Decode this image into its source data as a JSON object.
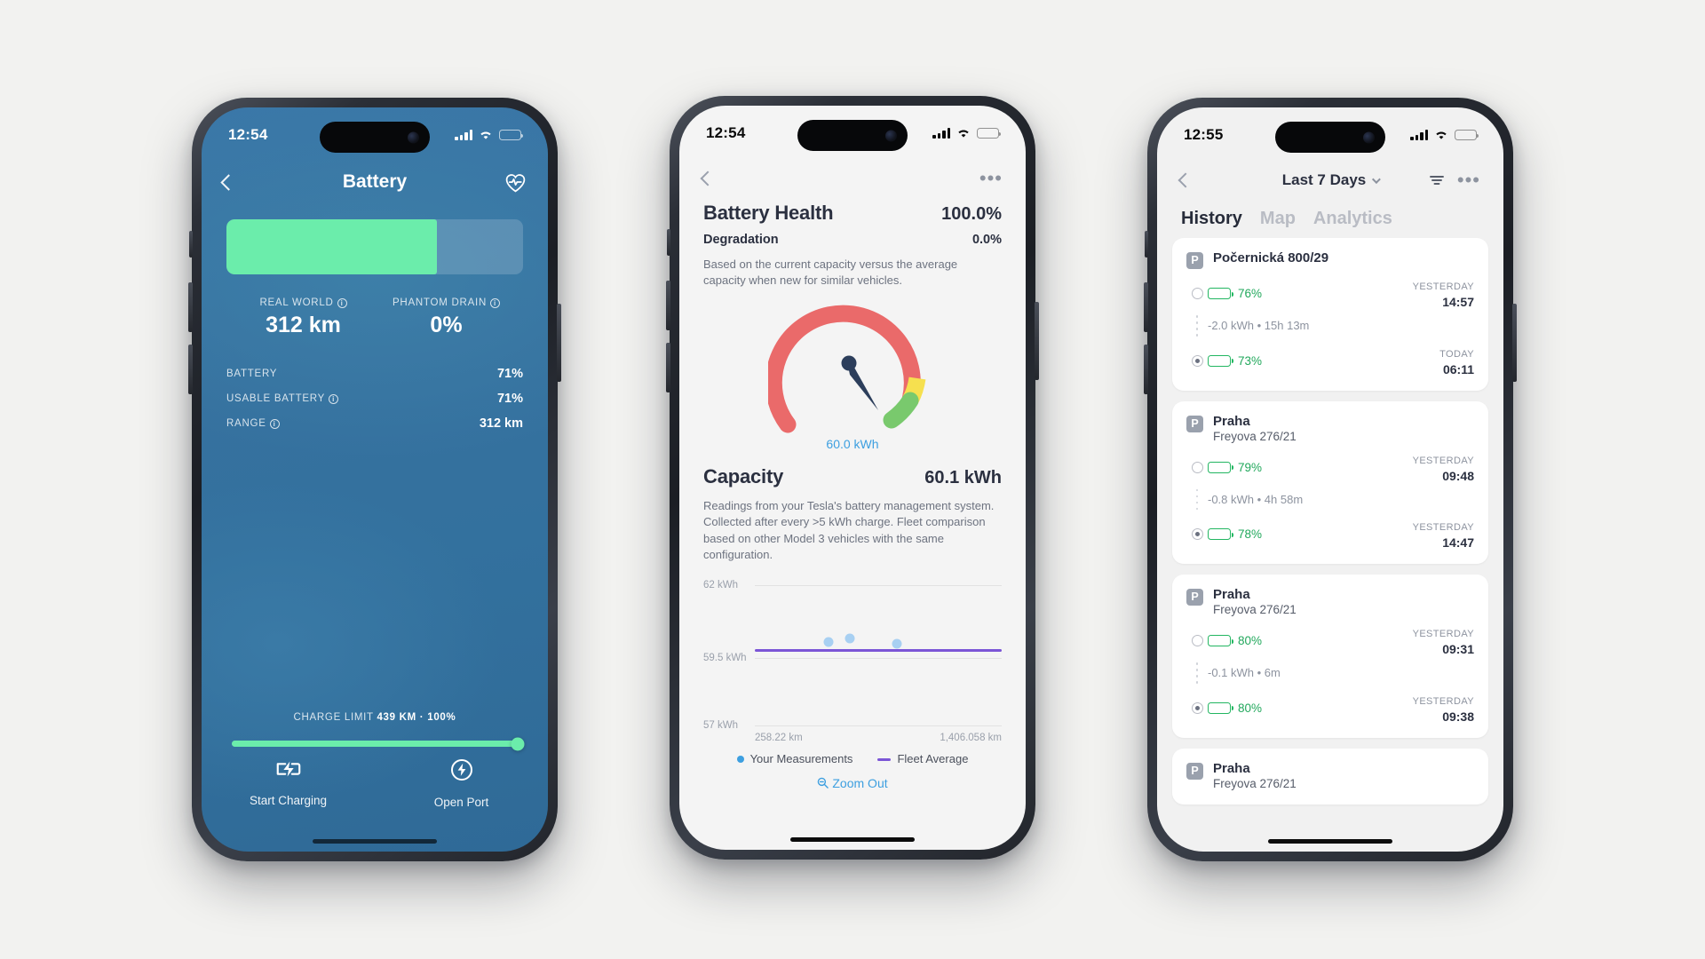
{
  "phone1": {
    "status": {
      "time": "12:54",
      "cellular_icon": "cellular-bars-icon",
      "wifi_icon": "wifi-icon",
      "battery_icon": "battery-icon"
    },
    "nav": {
      "back_icon": "chevron-left-icon",
      "title": "Battery",
      "health_icon": "heart-pulse-icon"
    },
    "battery_level_pct": 71,
    "accent_green": "#6bedab",
    "background_blue": "#36719f",
    "metrics": [
      {
        "caption": "REAL WORLD",
        "info_icon": "info-icon",
        "value": "312 km"
      },
      {
        "caption": "PHANTOM DRAIN",
        "info_icon": "info-icon",
        "value": "0%"
      }
    ],
    "rows": [
      {
        "label": "BATTERY",
        "info": false,
        "value": "71%"
      },
      {
        "label": "USABLE BATTERY",
        "info": true,
        "value": "71%"
      },
      {
        "label": "RANGE",
        "info": true,
        "value": "312 km"
      }
    ],
    "charge_limit": {
      "prefix": "CHARGE LIMIT",
      "value": "439 KM · 100%",
      "slider_pct": 100
    },
    "actions": [
      {
        "icon": "battery-bolt-icon",
        "label": "Start Charging"
      },
      {
        "icon": "bolt-circle-icon",
        "label": "Open Port"
      }
    ]
  },
  "phone2": {
    "status": {
      "time": "12:54",
      "cellular_icon": "cellular-bars-icon",
      "wifi_icon": "wifi-icon",
      "battery_icon": "battery-icon"
    },
    "nav": {
      "back_icon": "chevron-left-icon",
      "more_icon": "more-dots-icon"
    },
    "health": {
      "title": "Battery Health",
      "value": "100.0%",
      "sub_label": "Degradation",
      "sub_value": "0.0%",
      "description": "Based on the current capacity versus the average capacity when new for similar vehicles."
    },
    "gauge": {
      "value_label": "60.0 kWh",
      "red": "#ea6a6a",
      "yellow": "#f6e04f",
      "green": "#79c96d",
      "needle": "#2c3e5b"
    },
    "capacity": {
      "title": "Capacity",
      "value": "60.1 kWh",
      "description": "Readings from your Tesla's battery management system. Collected after every >5 kWh charge. Fleet comparison based on other Model 3 vehicles with the same configuration."
    },
    "legend": [
      {
        "marker": "dot",
        "label": "Your Measurements",
        "color": "#3d9fe0"
      },
      {
        "marker": "line",
        "label": "Fleet Average",
        "color": "#7b55d6"
      }
    ],
    "zoom_out": {
      "icon": "magnifier-minus-icon",
      "label": "Zoom Out"
    }
  },
  "phone3": {
    "status": {
      "time": "12:55",
      "cellular_icon": "cellular-bars-icon",
      "wifi_icon": "wifi-icon",
      "battery_icon": "battery-icon"
    },
    "nav": {
      "back_icon": "chevron-left-icon",
      "title": "Last 7 Days",
      "chevron_icon": "chevron-down-icon",
      "filter_icon": "filter-icon",
      "more_icon": "more-dots-icon"
    },
    "tabs": [
      {
        "label": "History",
        "active": true
      },
      {
        "label": "Map",
        "active": false
      },
      {
        "label": "Analytics",
        "active": false
      }
    ],
    "cards": [
      {
        "place_icon": "parking-icon",
        "title": "Počernická 800/29",
        "subtitle": "",
        "start": {
          "pct": "76%",
          "day": "YESTERDAY",
          "time": "14:57",
          "fill": 60
        },
        "delta": "-2.0 kWh • 15h 13m",
        "end": {
          "pct": "73%",
          "day": "TODAY",
          "time": "06:11",
          "fill": 57
        }
      },
      {
        "place_icon": "parking-icon",
        "title": "Praha",
        "subtitle": "Freyova 276/21",
        "start": {
          "pct": "79%",
          "day": "YESTERDAY",
          "time": "09:48",
          "fill": 63
        },
        "delta": "-0.8 kWh • 4h 58m",
        "end": {
          "pct": "78%",
          "day": "YESTERDAY",
          "time": "14:47",
          "fill": 62
        }
      },
      {
        "place_icon": "parking-icon",
        "title": "Praha",
        "subtitle": "Freyova 276/21",
        "start": {
          "pct": "80%",
          "day": "YESTERDAY",
          "time": "09:31",
          "fill": 64
        },
        "delta": "-0.1 kWh • 6m",
        "end": {
          "pct": "80%",
          "day": "YESTERDAY",
          "time": "09:38",
          "fill": 64
        }
      },
      {
        "place_icon": "parking-icon",
        "title": "Praha",
        "subtitle": "Freyova 276/21",
        "start": null,
        "delta": "",
        "end": null
      }
    ]
  },
  "chart_data": {
    "type": "scatter",
    "title": "Capacity",
    "xlabel": "",
    "ylabel": "kWh",
    "ylim": [
      57,
      62
    ],
    "xlim": [
      258.22,
      1406.058
    ],
    "ytick_labels": [
      "62 kWh",
      "59.5 kWh",
      "57 kWh"
    ],
    "yticks": [
      62,
      59.5,
      57
    ],
    "xtick_labels": [
      "258.22 km",
      "1,406.058 km"
    ],
    "grid": true,
    "legend_position": "bottom",
    "series": [
      {
        "name": "Your Measurements",
        "type": "scatter",
        "color": "#a8d0f2",
        "x": [
          820,
          900,
          1090
        ],
        "y": [
          59.75,
          59.85,
          59.7
        ]
      },
      {
        "name": "Fleet Average",
        "type": "line",
        "color": "#7b55d6",
        "x": [
          258.22,
          1406.058
        ],
        "y": [
          59.62,
          59.62
        ]
      }
    ]
  }
}
